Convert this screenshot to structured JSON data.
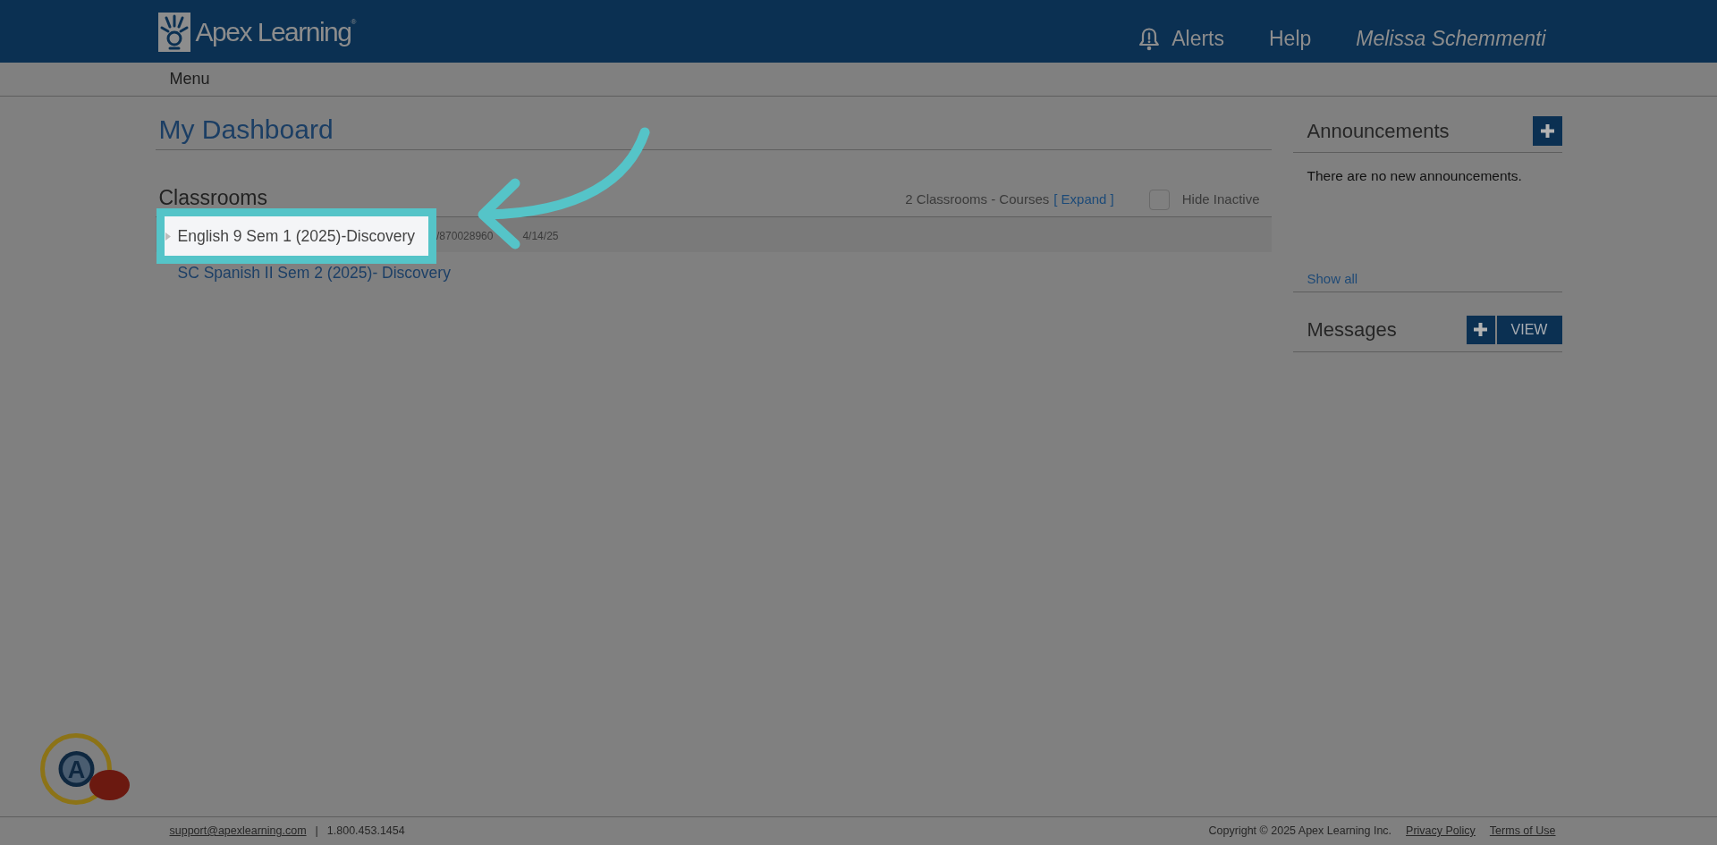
{
  "header": {
    "logo_text": "Apex Learning$^{®}$",
    "nav": [
      {
        "kind": "alerts",
        "label": "Alerts"
      },
      {
        "kind": "link",
        "label": "Help"
      },
      {
        "kind": "user",
        "label": "Melissa Schemmenti"
      }
    ]
  },
  "menu_bar": {
    "label": "Menu"
  },
  "dashboard": {
    "title": "My Dashboard",
    "classrooms": {
      "title": "Classrooms",
      "summary": "2 Classrooms - Courses",
      "expand_link": "[ Expand ]",
      "hide_inactive": {
        "label": "Hide Inactive",
        "checked": false
      },
      "rows": [
        {
          "title": "English 9 Sem 1 (2025)-Discovery",
          "highlighted": true,
          "code": "/870028960",
          "date": "4/14/25"
        },
        {
          "title": "SC Spanish II Sem 2 (2025)- Discovery",
          "highlighted": false
        }
      ]
    }
  },
  "announcements": {
    "title": "Announcements",
    "message": "There are no new announcements.",
    "show_all": "Show all"
  },
  "messages": {
    "title": "Messages",
    "view_button": "VIEW"
  },
  "widget": {
    "letter": "A"
  },
  "footer": {
    "email": "support@apexlearning.com",
    "separator": "|",
    "phone": "1.800.453.1454",
    "copyright": "Copyright © 2025 Apex Learning Inc.",
    "links": [
      "Privacy Policy",
      "Terms of Use"
    ]
  }
}
